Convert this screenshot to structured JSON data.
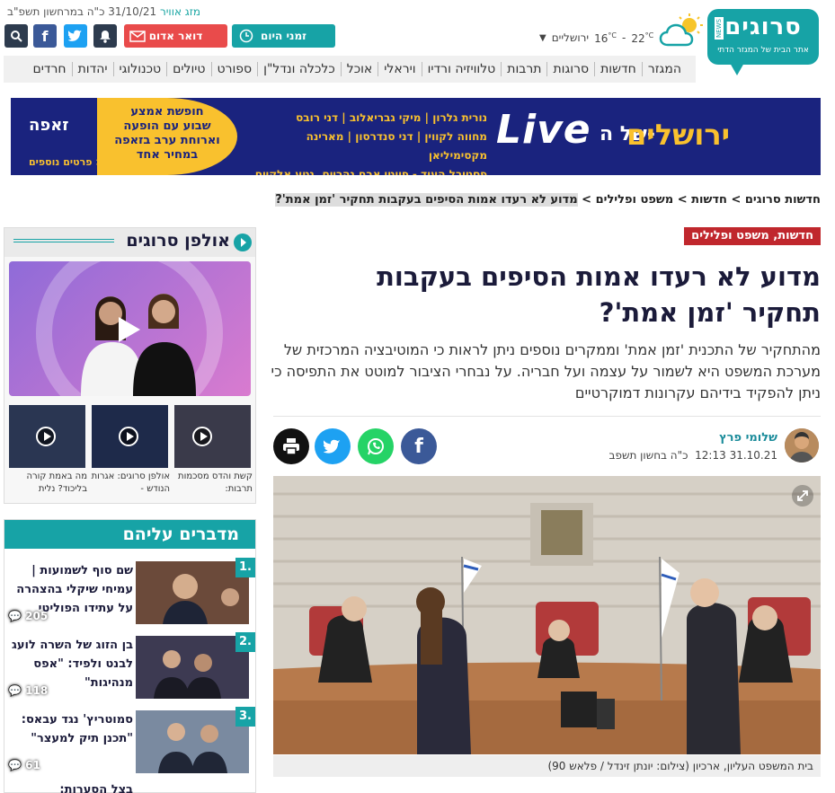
{
  "header": {
    "weather_line_label": "מזג אוויר",
    "date_line": "31/10/21 כ\"ה במרחשון תשפ\"ב",
    "zmanei_hayom": "זמני היום",
    "doar_adom": "דואר אדום",
    "weather_city": "ירושליים",
    "weather_low": "16",
    "weather_high": "22",
    "weather_unit": "°C",
    "logo_text": "סרוגים",
    "logo_sub": "אתר הבית של המגזר הדתי",
    "logo_badge": "NEWS"
  },
  "nav": [
    "המגזר",
    "חדשות",
    "סרוגות",
    "תרבות",
    "טלוויזיה ורדיו",
    "ויראלי",
    "אוכל",
    "כלכלה ונדל\"ן",
    "ספורט",
    "טיולים",
    "טכנולוגי",
    "יהדות",
    "חרדים"
  ],
  "banner": {
    "jerusalem": "ירושלים",
    "shel_ha": "של ה-",
    "live": "Live",
    "names": [
      "נורית גלרון | מיקי גבריאלוב | דני רובס",
      "מחווה לקווין | דני סנדרסון | מארינה מקסימיליאן",
      "פסטיבל העוד - פיוטי ארם נהריים, נטע אלקיים"
    ],
    "promo": [
      "חופשת אמצע",
      "שבוע עם הופעה",
      "וארוחת ערב בזאפה",
      "במחיר אחד"
    ],
    "zappa": "זאפה",
    "more": "פרטים נוספים >"
  },
  "breadcrumb": {
    "items": [
      "חדשות סרוגים",
      "חדשות",
      "משפט ופלילים"
    ],
    "sep": " > ",
    "current": "מדוע לא רעדו אמות הסיפים בעקבות תחקיר 'זמן אמת'?"
  },
  "article": {
    "category": "חדשות, משפט ופלילים",
    "title": "מדוע לא רעדו אמות הסיפים בעקבות תחקיר 'זמן אמת'?",
    "subtitle": "מהתחקיר של התכנית 'זמן אמת' וממקרים נוספים ניתן לראות כי המוטיבציה המרכזית של מערכת המשפט היא לשמור על עצמה ועל חבריה. על נבחרי הציבור למוטט את התפיסה כי ניתן להפקיד בידיהם עקרונות דמוקרטיים",
    "author": "שלומי פרץ",
    "date": "31.10.21 12:13",
    "hebrew_date": "כ\"ה בחשון תשפב",
    "caption": "בית המשפט העליון, ארכיון (צילום: יונתן זינדל / פלאש 90)"
  },
  "sidebar_video": {
    "title": "אולפן סרוגים",
    "thumbs": [
      {
        "caption": "קשת והדס מסכמות תרבות:"
      },
      {
        "caption": "אולפן סרוגים: אגרות הנודש -"
      },
      {
        "caption": "מה באמת קורה בליכוד? נלית"
      }
    ]
  },
  "talked_about": {
    "title": "מדברים עליהם",
    "items": [
      {
        "num": "1.",
        "text": "שם סוף לשמועות | עמיחי שיקלי בהצהרה על עתידו הפוליטי",
        "count": "205"
      },
      {
        "num": "2.",
        "text": "בן הזוג של השרה לועג לבנט ולפיד: \"אפס מנהיגות\"",
        "count": "118"
      },
      {
        "num": "3.",
        "text": "סמוטריץ' נגד עבאס: \"תכנן תיק למעצר\"",
        "count": "61"
      }
    ],
    "partial": "בצל הסערות:"
  },
  "colors": {
    "brand": "#17a3a6",
    "category": "#c0272d",
    "facebook": "#3b5998",
    "twitter": "#1da1f2",
    "whatsapp": "#25d366"
  }
}
